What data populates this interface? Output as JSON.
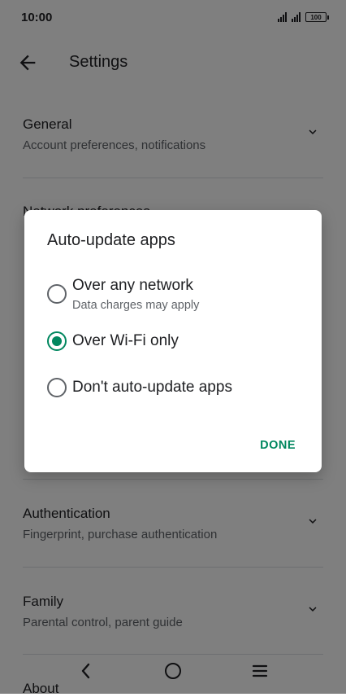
{
  "status_bar": {
    "time": "10:00",
    "battery": "100"
  },
  "app_bar": {
    "title": "Settings",
    "back_icon": "arrow-back-icon"
  },
  "settings_list": [
    {
      "title": "General",
      "subtitle": "Account preferences, notifications"
    },
    {
      "title": "Network preferences"
    },
    {
      "title": "Authentication",
      "subtitle": "Fingerprint, purchase authentication"
    },
    {
      "title": "Family",
      "subtitle": "Parental control, parent guide"
    },
    {
      "title": "About"
    }
  ],
  "dialog": {
    "title": "Auto-update apps",
    "options": [
      {
        "label": "Over any network",
        "sublabel": "Data charges may apply",
        "selected": false
      },
      {
        "label": "Over Wi-Fi only",
        "selected": true
      },
      {
        "label": "Don't auto-update apps",
        "selected": false
      }
    ],
    "done_label": "DONE"
  },
  "colors": {
    "accent": "#01875f",
    "scrim": "rgba(0,0,0,0.5)"
  },
  "nav_bar": {
    "icons": [
      "nav-back-icon",
      "nav-home-icon",
      "nav-menu-icon"
    ]
  }
}
